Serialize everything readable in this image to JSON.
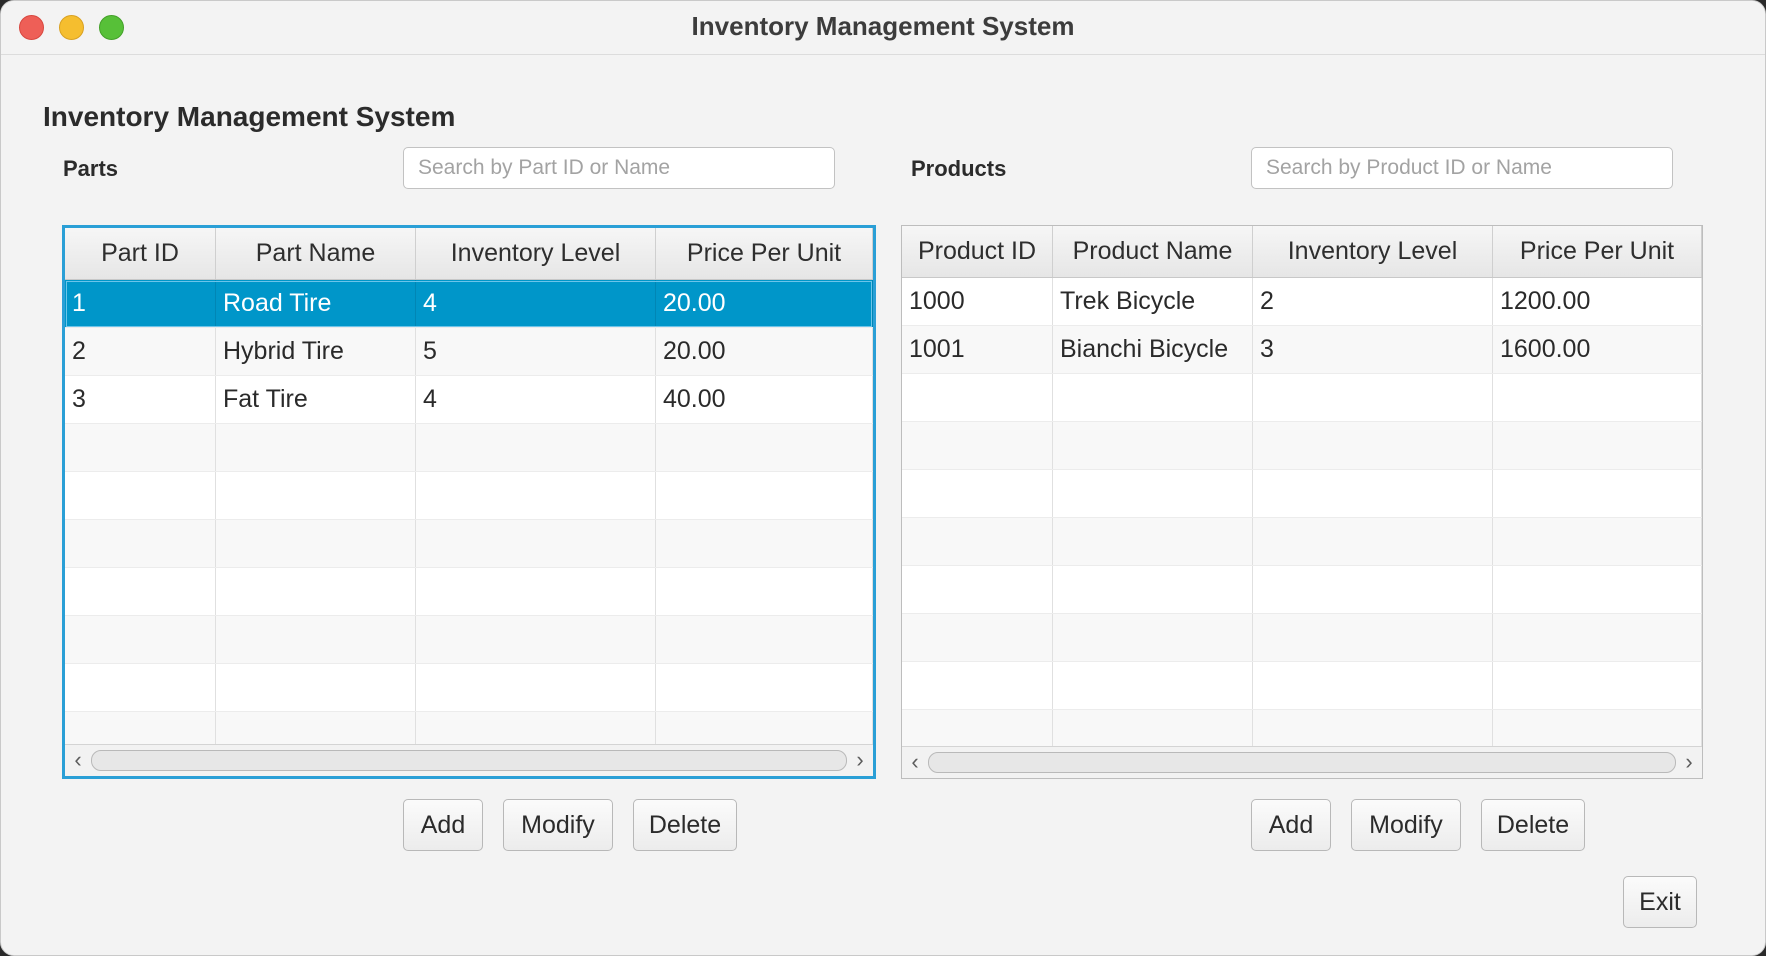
{
  "window": {
    "title": "Inventory Management System"
  },
  "app": {
    "heading": "Inventory Management System"
  },
  "parts": {
    "label": "Parts",
    "search_placeholder": "Search by Part ID or Name",
    "columns": [
      "Part ID",
      "Part Name",
      "Inventory Level",
      "Price Per Unit"
    ],
    "rows": [
      [
        "1",
        "Road Tire",
        "4",
        "20.00"
      ],
      [
        "2",
        "Hybrid Tire",
        "5",
        "20.00"
      ],
      [
        "3",
        "Fat Tire",
        "4",
        "40.00"
      ]
    ],
    "buttons": {
      "add": "Add",
      "modify": "Modify",
      "delete": "Delete"
    }
  },
  "products": {
    "label": "Products",
    "search_placeholder": "Search by Product ID or Name",
    "columns": [
      "Product ID",
      "Product Name",
      "Inventory Level",
      "Price Per Unit"
    ],
    "rows": [
      [
        "1000",
        "Trek Bicycle",
        "2",
        "1200.00"
      ],
      [
        "1001",
        "Bianchi Bicycle",
        "3",
        "1600.00"
      ]
    ],
    "buttons": {
      "add": "Add",
      "modify": "Modify",
      "delete": "Delete"
    }
  },
  "exit_label": "Exit",
  "icons": {
    "scroll_left": "‹",
    "scroll_right": "›"
  },
  "colors": {
    "selection": "#0096c9",
    "focus": "#2a9fd6"
  }
}
